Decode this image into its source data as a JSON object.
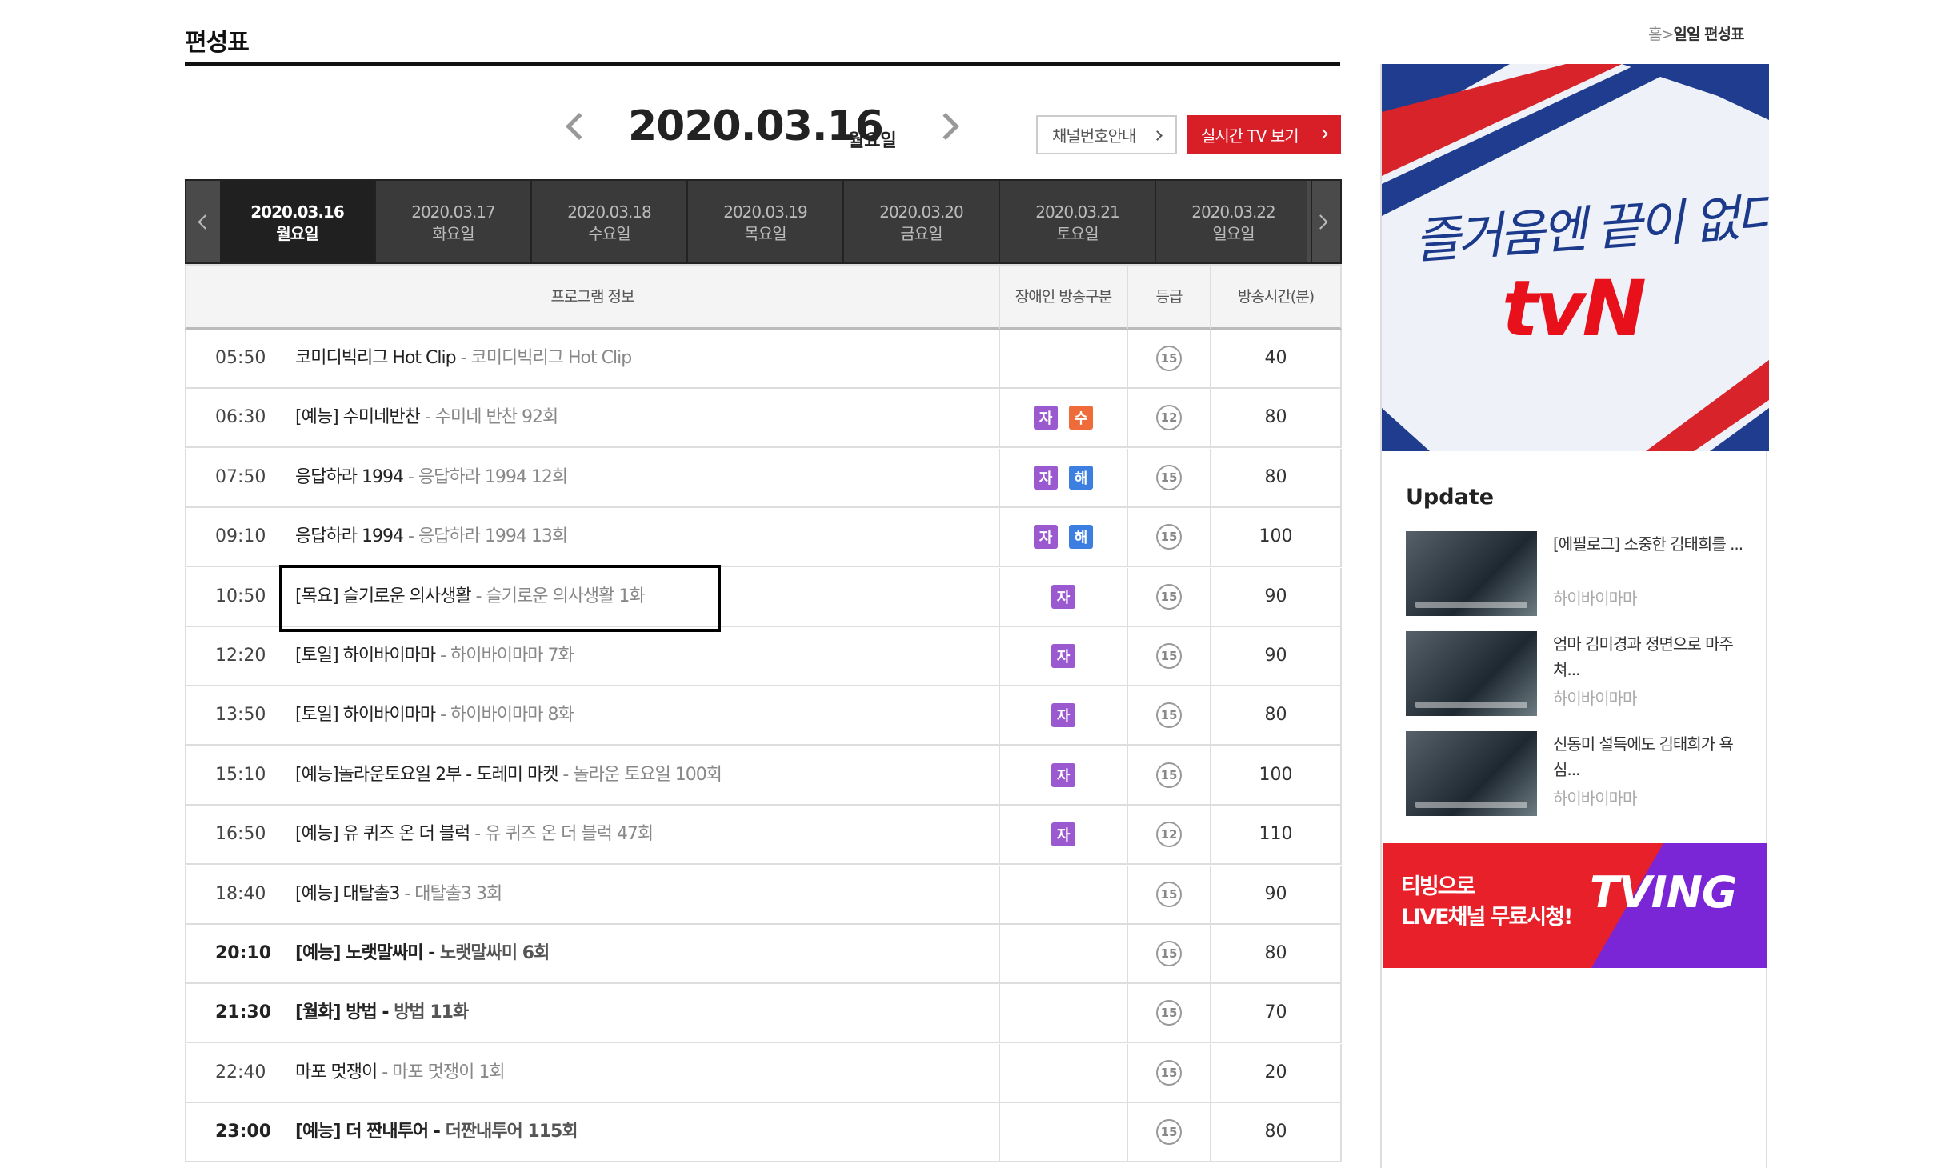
{
  "header": {
    "title": "편성표",
    "breadcrumb_home": "홈",
    "breadcrumb_sep": ">",
    "breadcrumb_current": "일일 편성표"
  },
  "date_nav": {
    "date": "2020.03.16",
    "day": "월요일",
    "channel_button": "채널번호안내",
    "live_button": "실시간 TV 보기"
  },
  "tabs": [
    {
      "date": "2020.03.16",
      "day": "월요일",
      "active": true
    },
    {
      "date": "2020.03.17",
      "day": "화요일",
      "active": false
    },
    {
      "date": "2020.03.18",
      "day": "수요일",
      "active": false
    },
    {
      "date": "2020.03.19",
      "day": "목요일",
      "active": false
    },
    {
      "date": "2020.03.20",
      "day": "금요일",
      "active": false
    },
    {
      "date": "2020.03.21",
      "day": "토요일",
      "active": false
    },
    {
      "date": "2020.03.22",
      "day": "일요일",
      "active": false
    }
  ],
  "table": {
    "headers": [
      "프로그램 정보",
      "장애인 방송구분",
      "등급",
      "방송시간(분)"
    ],
    "rows": [
      {
        "time": "05:50",
        "name": "코미디빅리그 Hot Clip",
        "episode": "코미디빅리그 Hot Clip",
        "badges": [],
        "grade": "15",
        "minutes": "40",
        "bold": false
      },
      {
        "time": "06:30",
        "name": "[예능] 수미네반찬",
        "episode": "수미네 반찬 92회",
        "badges": [
          {
            "label": "자",
            "color": "#9b59d0"
          },
          {
            "label": "수",
            "color": "#ef6c3a"
          }
        ],
        "grade": "12",
        "minutes": "80",
        "bold": false
      },
      {
        "time": "07:50",
        "name": "응답하라 1994",
        "episode": "응답하라 1994 12회",
        "badges": [
          {
            "label": "자",
            "color": "#9b59d0"
          },
          {
            "label": "해",
            "color": "#3d7fe0"
          }
        ],
        "grade": "15",
        "minutes": "80",
        "bold": false
      },
      {
        "time": "09:10",
        "name": "응답하라 1994",
        "episode": "응답하라 1994 13회",
        "badges": [
          {
            "label": "자",
            "color": "#9b59d0"
          },
          {
            "label": "해",
            "color": "#3d7fe0"
          }
        ],
        "grade": "15",
        "minutes": "100",
        "bold": false
      },
      {
        "time": "10:50",
        "name": "[목요] 슬기로운 의사생활",
        "episode": "슬기로운 의사생활 1화",
        "badges": [
          {
            "label": "자",
            "color": "#9b59d0"
          }
        ],
        "grade": "15",
        "minutes": "90",
        "bold": false
      },
      {
        "time": "12:20",
        "name": "[토일] 하이바이마마",
        "episode": "하이바이마마 7화",
        "badges": [
          {
            "label": "자",
            "color": "#9b59d0"
          }
        ],
        "grade": "15",
        "minutes": "90",
        "bold": false
      },
      {
        "time": "13:50",
        "name": "[토일] 하이바이마마",
        "episode": "하이바이마마 8화",
        "badges": [
          {
            "label": "자",
            "color": "#9b59d0"
          }
        ],
        "grade": "15",
        "minutes": "80",
        "bold": false
      },
      {
        "time": "15:10",
        "name": "[예능]놀라운토요일 2부 - 도레미 마켓",
        "episode": "놀라운 토요일 100회",
        "badges": [
          {
            "label": "자",
            "color": "#9b59d0"
          }
        ],
        "grade": "15",
        "minutes": "100",
        "bold": false
      },
      {
        "time": "16:50",
        "name": "[예능] 유 퀴즈 온 더 블럭",
        "episode": "유 퀴즈 온 더 블럭 47회",
        "badges": [
          {
            "label": "자",
            "color": "#9b59d0"
          }
        ],
        "grade": "12",
        "minutes": "110",
        "bold": false
      },
      {
        "time": "18:40",
        "name": "[예능] 대탈출3",
        "episode": "대탈출3 3회",
        "badges": [],
        "grade": "15",
        "minutes": "90",
        "bold": false
      },
      {
        "time": "20:10",
        "name": "[예능] 노랫말싸미",
        "episode": "노랫말싸미 6회",
        "badges": [],
        "grade": "15",
        "minutes": "80",
        "bold": true
      },
      {
        "time": "21:30",
        "name": "[월화] 방법",
        "episode": "방법 11화",
        "badges": [],
        "grade": "15",
        "minutes": "70",
        "bold": true
      },
      {
        "time": "22:40",
        "name": "마포 멋쟁이",
        "episode": "마포 멋쟁이 1회",
        "badges": [],
        "grade": "15",
        "minutes": "20",
        "bold": false
      },
      {
        "time": "23:00",
        "name": "[예능] 더 짠내투어",
        "episode": "더짠내투어 115회",
        "badges": [],
        "grade": "15",
        "minutes": "80",
        "bold": true
      }
    ]
  },
  "sidebar": {
    "promo_slogan": "즐거움엔 끝이 없다",
    "promo_logo": "tvN",
    "update_title": "Update",
    "updates": [
      {
        "title": "[에필로그] 소중한 김태희를 ...",
        "program": "하이바이마마"
      },
      {
        "title": "엄마 김미경과 정면으로 마주쳐...",
        "program": "하이바이마마"
      },
      {
        "title": "신동미 설득에도 김태희가 욕심...",
        "program": "하이바이마마"
      }
    ],
    "tving_text_1": "티빙으로",
    "tving_text_2": "LIVE채널 무료시청!",
    "tving_logo": "TVING"
  },
  "colors": {
    "accent_red": "#d81e27",
    "tab_bg": "#3a3a3a",
    "badge_ja": "#9b59d0",
    "badge_su": "#ef6c3a",
    "badge_hae": "#3d7fe0"
  }
}
